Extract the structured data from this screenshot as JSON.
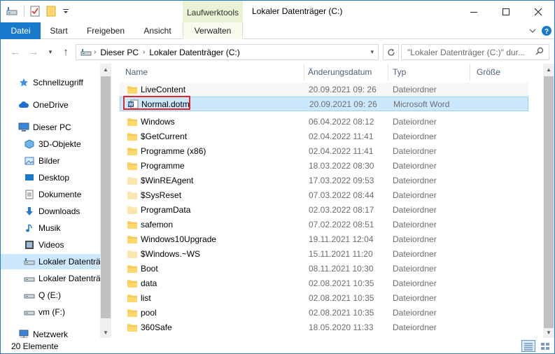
{
  "window": {
    "title": "Lokaler Datenträger (C:)",
    "context_tab_group": "Laufwerktools"
  },
  "ribbon": {
    "tabs": [
      "Datei",
      "Start",
      "Freigeben",
      "Ansicht",
      "Verwalten"
    ]
  },
  "address": {
    "segments": [
      "Dieser PC",
      "Lokaler Datenträger (C:)"
    ],
    "search_placeholder": "\"Lokaler Datenträger (C:)\" dur..."
  },
  "nav": {
    "items": [
      {
        "label": "Schnellzugriff",
        "icon": "star-icon"
      },
      {
        "label": "OneDrive",
        "icon": "cloud-icon"
      },
      {
        "label": "Dieser PC",
        "icon": "computer-icon"
      },
      {
        "label": "3D-Objekte",
        "icon": "cube-icon"
      },
      {
        "label": "Bilder",
        "icon": "pictures-icon"
      },
      {
        "label": "Desktop",
        "icon": "desktop-icon"
      },
      {
        "label": "Dokumente",
        "icon": "document-icon"
      },
      {
        "label": "Downloads",
        "icon": "download-icon"
      },
      {
        "label": "Musik",
        "icon": "music-icon"
      },
      {
        "label": "Videos",
        "icon": "video-icon"
      },
      {
        "label": "Lokaler Datenträ",
        "icon": "drive-icon",
        "selected": true
      },
      {
        "label": "Lokaler Datenträ",
        "icon": "drive-icon"
      },
      {
        "label": "Q (E:)",
        "icon": "drive-icon"
      },
      {
        "label": "vm (F:)",
        "icon": "drive-icon"
      },
      {
        "label": "Netzwerk",
        "icon": "network-icon"
      }
    ]
  },
  "columns": {
    "name": "Name",
    "date": "Änderungsdatum",
    "type": "Typ",
    "size": "Größe"
  },
  "files": [
    {
      "name": "LiveContent",
      "date": "20.09.2021 09: 26",
      "type": "Dateiordner",
      "icon": "folder-icon"
    },
    {
      "name": "Normal.dotm",
      "date": "20.09.2021 09: 26",
      "type": "Microsoft Word",
      "icon": "word-template-icon",
      "selected": true
    },
    {
      "name": "Windows",
      "date": "06.04.2022 08:12",
      "type": "Dateiordner",
      "icon": "folder-icon"
    },
    {
      "name": "$GetCurrent",
      "date": "02.04.2022 11:41",
      "type": "Dateiordner",
      "icon": "folder-icon"
    },
    {
      "name": "Programme (x86)",
      "date": "02.04.2022 11:41",
      "type": "Dateiordner",
      "icon": "folder-icon"
    },
    {
      "name": "Programme",
      "date": "18.03.2022 08:30",
      "type": "Dateiordner",
      "icon": "folder-icon"
    },
    {
      "name": "$WinREAgent",
      "date": "17.03.2022 09:53",
      "type": "Dateiordner",
      "icon": "folder-hidden-icon"
    },
    {
      "name": "$SysReset",
      "date": "07.03.2022 08:44",
      "type": "Dateiordner",
      "icon": "folder-hidden-icon"
    },
    {
      "name": "ProgramData",
      "date": "02.03.2022 08:17",
      "type": "Dateiordner",
      "icon": "folder-hidden-icon"
    },
    {
      "name": "safemon",
      "date": "07.02.2022 08:51",
      "type": "Dateiordner",
      "icon": "folder-icon"
    },
    {
      "name": "Windows10Upgrade",
      "date": "19.11.2021 12:04",
      "type": "Dateiordner",
      "icon": "folder-icon"
    },
    {
      "name": "$Windows.~WS",
      "date": "15.11.2021 11:20",
      "type": "Dateiordner",
      "icon": "folder-hidden-icon"
    },
    {
      "name": "Boot",
      "date": "08.11.2021 10:30",
      "type": "Dateiordner",
      "icon": "folder-icon"
    },
    {
      "name": "data",
      "date": "02.08.2021 10:35",
      "type": "Dateiordner",
      "icon": "folder-icon"
    },
    {
      "name": "list",
      "date": "02.08.2021 10:35",
      "type": "Dateiordner",
      "icon": "folder-icon"
    },
    {
      "name": "pool",
      "date": "02.08.2021 10:35",
      "type": "Dateiordner",
      "icon": "folder-icon"
    },
    {
      "name": "360Safe",
      "date": "18.05.2020 11:33",
      "type": "Dateiordner",
      "icon": "folder-icon"
    }
  ],
  "status": {
    "count_text": "20 Elemente"
  },
  "colors": {
    "accent": "#1979ca",
    "selection": "#cce8ff",
    "highlight_box": "#e0262b",
    "folder": "#ffd86b"
  }
}
